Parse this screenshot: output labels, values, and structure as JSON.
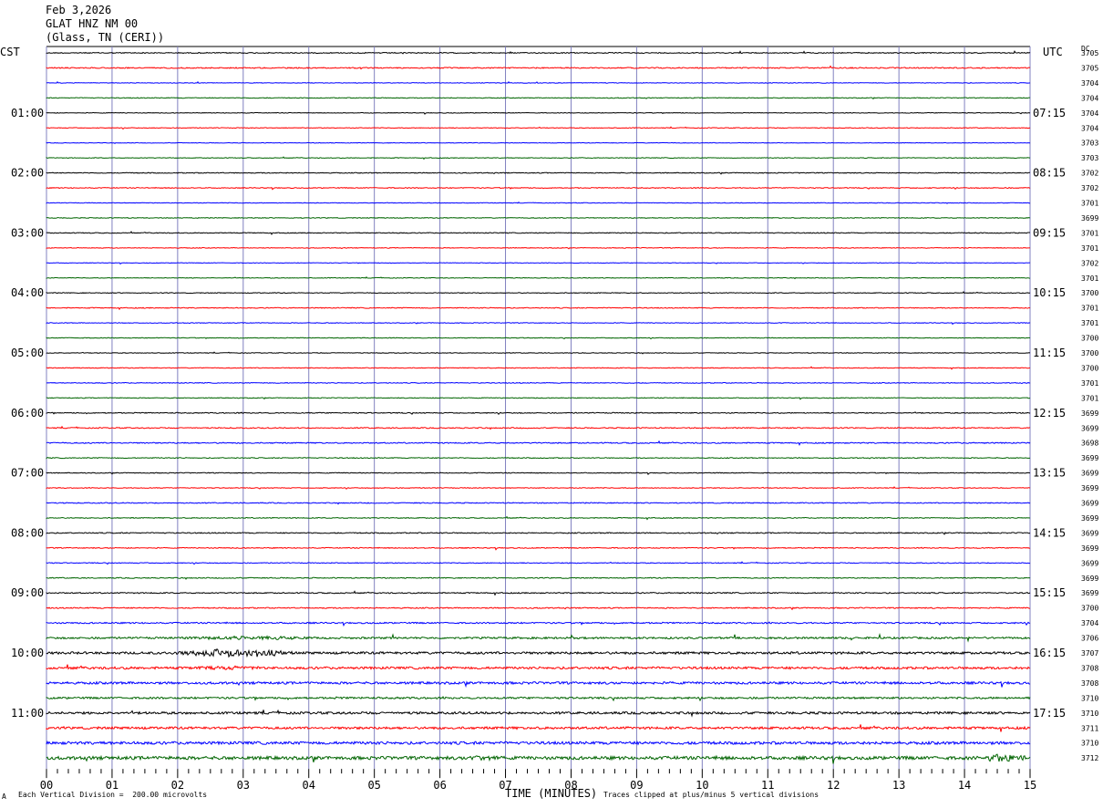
{
  "header": {
    "date": "Feb 3,2026",
    "station": "GLAT HNZ NM 00",
    "location": "(Glass, TN (CERI))"
  },
  "left_timezone": "CST",
  "right_timezone": "UTC",
  "dc_label": "DC",
  "footer": {
    "scale_note": "Each Vertical Division =  200.00 microvolts",
    "xlabel": "TIME (MINUTES)",
    "clip_note": "Traces clipped at plus/minus 5 vertical divisions",
    "corner_mark": "A"
  },
  "colors": {
    "black": "#000000",
    "red": "#ff0000",
    "blue": "#0000ff",
    "green": "#006400",
    "grid": "#8080c0"
  },
  "chart_data": {
    "type": "line",
    "title": "GLAT HNZ NM 00",
    "xlabel": "TIME (MINUTES)",
    "x_ticks": [
      "00",
      "01",
      "02",
      "03",
      "04",
      "05",
      "06",
      "07",
      "08",
      "09",
      "10",
      "11",
      "12",
      "13",
      "14",
      "15"
    ],
    "xlim": [
      0,
      15
    ],
    "trace_minutes": 15,
    "trace_count": 48,
    "trace_color_cycle": [
      "black",
      "red",
      "blue",
      "green"
    ],
    "left_hour_labels": [
      "01:00",
      "02:00",
      "03:00",
      "04:00",
      "05:00",
      "06:00",
      "07:00",
      "08:00",
      "09:00",
      "10:00",
      "11:00"
    ],
    "right_hour_labels": [
      "07:15",
      "08:15",
      "09:15",
      "10:15",
      "11:15",
      "12:15",
      "13:15",
      "14:15",
      "15:15",
      "16:15",
      "17:15"
    ],
    "dc_offsets": [
      3705,
      3705,
      3704,
      3704,
      3704,
      3704,
      3703,
      3703,
      3702,
      3702,
      3701,
      3699,
      3701,
      3701,
      3702,
      3701,
      3700,
      3701,
      3701,
      3700,
      3700,
      3700,
      3701,
      3701,
      3699,
      3699,
      3698,
      3699,
      3699,
      3699,
      3699,
      3699,
      3699,
      3699,
      3699,
      3699,
      3699,
      3700,
      3704,
      3706,
      3707,
      3708,
      3708,
      3710,
      3710,
      3711,
      3710,
      3712
    ],
    "noise_levels": [
      1.0,
      1.2,
      0.6,
      0.8,
      0.7,
      0.8,
      0.6,
      0.7,
      0.9,
      0.9,
      0.6,
      0.8,
      0.9,
      0.7,
      0.6,
      0.7,
      0.8,
      0.9,
      0.7,
      0.7,
      0.7,
      0.8,
      0.8,
      0.8,
      1.0,
      1.1,
      1.2,
      0.9,
      0.8,
      0.8,
      1.0,
      0.9,
      1.1,
      1.0,
      0.9,
      1.0,
      1.2,
      1.2,
      1.5,
      2.0,
      2.5,
      2.5,
      2.5,
      2.0,
      2.5,
      2.5,
      3.0,
      3.5
    ],
    "events": [
      {
        "trace": 39,
        "start_min": 2.0,
        "end_min": 4.2,
        "amplitude": 2.5
      },
      {
        "trace": 40,
        "start_min": 1.9,
        "end_min": 3.8,
        "amplitude": 8.0
      },
      {
        "trace": 41,
        "start_min": 2.2,
        "end_min": 3.4,
        "amplitude": 2.0
      },
      {
        "trace": 47,
        "start_min": 6.4,
        "end_min": 6.9,
        "amplitude": 3.0
      },
      {
        "trace": 47,
        "start_min": 14.2,
        "end_min": 15.0,
        "amplitude": 8.0
      }
    ]
  }
}
